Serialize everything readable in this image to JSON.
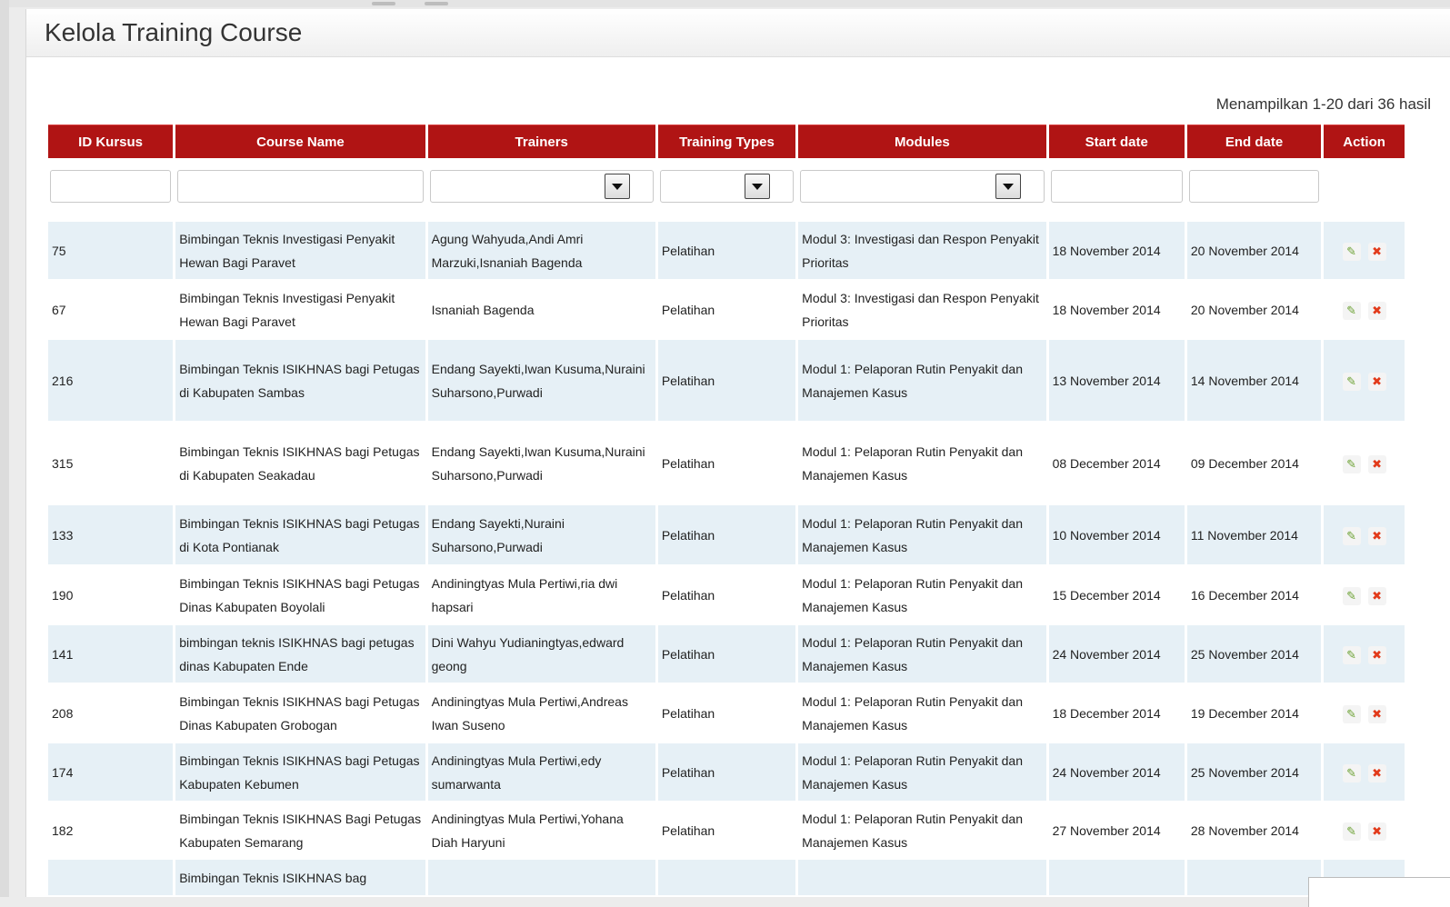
{
  "page": {
    "title": "Kelola Training Course"
  },
  "summary": "Menampilkan 1-20 dari 36 hasil",
  "columns": {
    "id": "ID Kursus",
    "course_name": "Course Name",
    "trainers": "Trainers",
    "training_types": "Training Types",
    "modules": "Modules",
    "start_date": "Start date",
    "end_date": "End date",
    "action": "Action"
  },
  "icons": {
    "edit": "pencil-icon",
    "delete": "close-icon"
  },
  "colors": {
    "header_bg": "#b01414",
    "row_alt": "#e6f0f6"
  },
  "rows": [
    {
      "id": "75",
      "course": "Bimbingan Teknis Investigasi Penyakit Hewan Bagi Paravet",
      "trainers": "Agung Wahyuda,Andi Amri Marzuki,Isnaniah Bagenda",
      "type": "Pelatihan",
      "module": "Modul 3: Investigasi dan Respon Penyakit Prioritas",
      "start": "18 November 2014",
      "end": "20 November 2014"
    },
    {
      "id": "67",
      "course": "Bimbingan Teknis Investigasi Penyakit Hewan Bagi Paravet",
      "trainers": "Isnaniah Bagenda",
      "type": "Pelatihan",
      "module": "Modul 3: Investigasi dan Respon Penyakit Prioritas",
      "start": "18 November 2014",
      "end": "20 November 2014"
    },
    {
      "id": "216",
      "course": "Bimbingan Teknis ISIKHNAS bagi Petugas di Kabupaten Sambas",
      "trainers": "Endang Sayekti,Iwan Kusuma,Nuraini Suharsono,Purwadi",
      "type": "Pelatihan",
      "module": "Modul 1: Pelaporan Rutin Penyakit dan Manajemen Kasus",
      "start": "13 November 2014",
      "end": "14 November 2014"
    },
    {
      "id": "315",
      "course": "Bimbingan Teknis ISIKHNAS bagi Petugas di Kabupaten Seakadau",
      "trainers": "Endang Sayekti,Iwan Kusuma,Nuraini Suharsono,Purwadi",
      "type": "Pelatihan",
      "module": "Modul 1: Pelaporan Rutin Penyakit dan Manajemen Kasus",
      "start": "08 December 2014",
      "end": "09 December 2014"
    },
    {
      "id": "133",
      "course": "Bimbingan Teknis ISIKHNAS bagi Petugas di Kota Pontianak",
      "trainers": "Endang Sayekti,Nuraini Suharsono,Purwadi",
      "type": "Pelatihan",
      "module": "Modul 1: Pelaporan Rutin Penyakit dan Manajemen Kasus",
      "start": "10 November 2014",
      "end": "11 November 2014"
    },
    {
      "id": "190",
      "course": "Bimbingan Teknis ISIKHNAS bagi Petugas Dinas Kabupaten Boyolali",
      "trainers": "Andiningtyas Mula Pertiwi,ria dwi hapsari",
      "type": "Pelatihan",
      "module": "Modul 1: Pelaporan Rutin Penyakit dan Manajemen Kasus",
      "start": "15 December 2014",
      "end": "16 December 2014"
    },
    {
      "id": "141",
      "course": "bimbingan teknis ISIKHNAS bagi petugas dinas Kabupaten Ende",
      "trainers": "Dini Wahyu Yudianingtyas,edward geong",
      "type": "Pelatihan",
      "module": "Modul 1: Pelaporan Rutin Penyakit dan Manajemen Kasus",
      "start": "24 November 2014",
      "end": "25 November 2014"
    },
    {
      "id": "208",
      "course": "Bimbingan Teknis ISIKHNAS bagi Petugas Dinas Kabupaten Grobogan",
      "trainers": "Andiningtyas Mula Pertiwi,Andreas Iwan Suseno",
      "type": "Pelatihan",
      "module": "Modul 1: Pelaporan Rutin Penyakit dan Manajemen Kasus",
      "start": "18 December 2014",
      "end": "19 December 2014"
    },
    {
      "id": "174",
      "course": "Bimbingan Teknis ISIKHNAS bagi Petugas Kabupaten Kebumen",
      "trainers": "Andiningtyas Mula Pertiwi,edy sumarwanta",
      "type": "Pelatihan",
      "module": "Modul 1: Pelaporan Rutin Penyakit dan Manajemen Kasus",
      "start": "24 November 2014",
      "end": "25 November 2014"
    },
    {
      "id": "182",
      "course": "Bimbingan Teknis ISIKHNAS Bagi Petugas Kabupaten Semarang",
      "trainers": "Andiningtyas Mula Pertiwi,Yohana Diah Haryuni",
      "type": "Pelatihan",
      "module": "Modul 1: Pelaporan Rutin Penyakit dan Manajemen Kasus",
      "start": "27 November 2014",
      "end": "28 November 2014"
    },
    {
      "id": "",
      "course": "Bimbingan Teknis ISIKHNAS bag",
      "trainers": "",
      "type": "",
      "module": "",
      "start": "",
      "end": ""
    }
  ]
}
